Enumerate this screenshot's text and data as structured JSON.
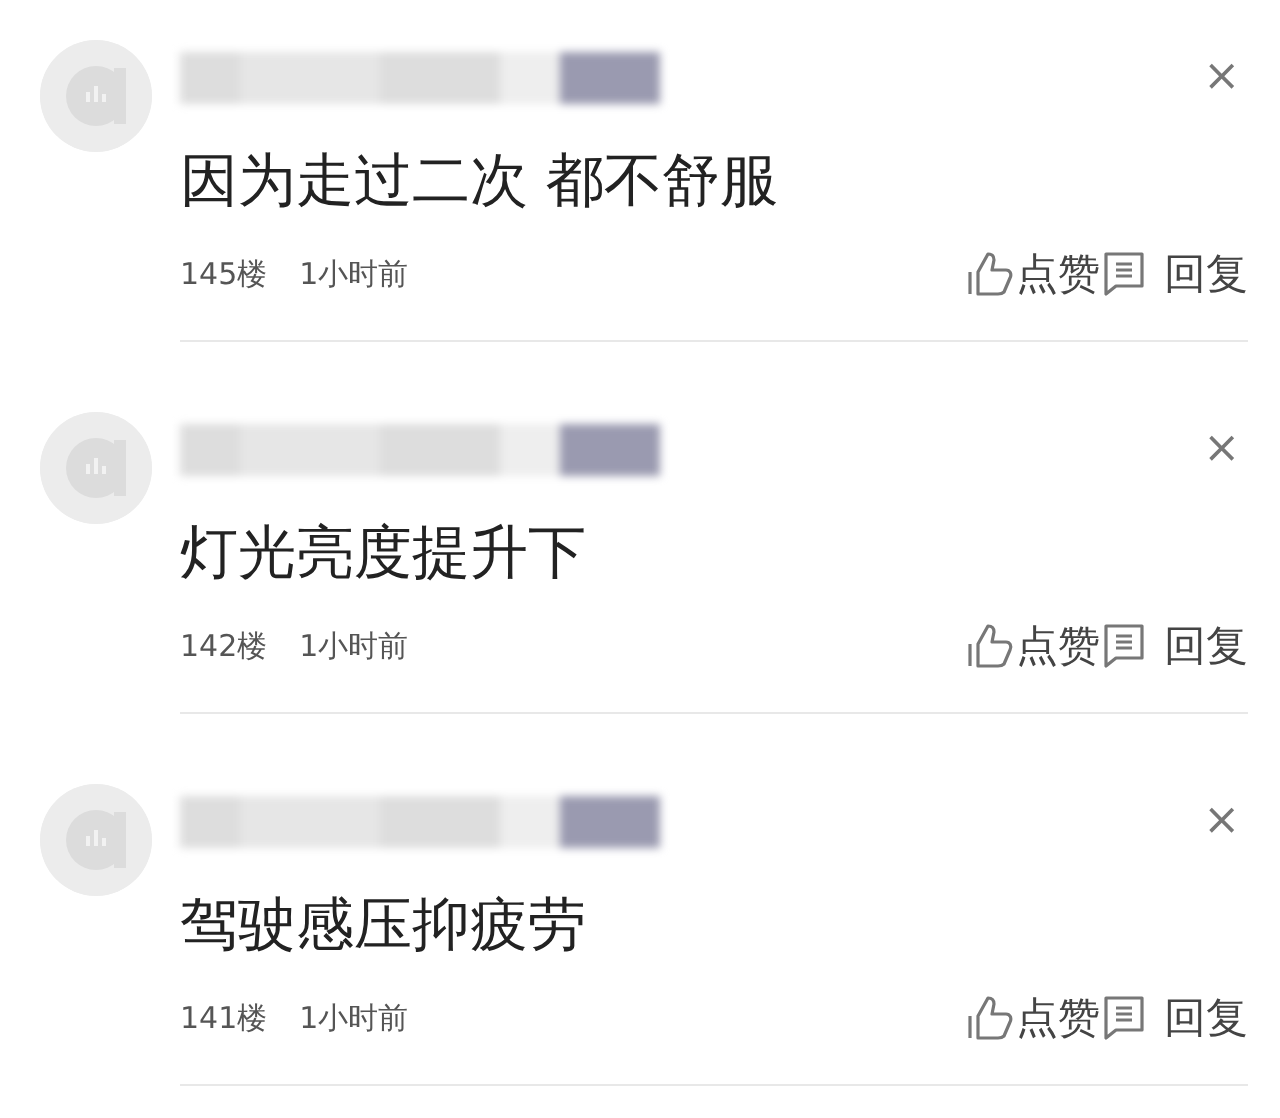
{
  "comments": [
    {
      "text": "因为走过二次 都不舒服",
      "floor": "145楼",
      "time": "1小时前",
      "like_label": "点赞",
      "reply_label": "回复",
      "close": "×"
    },
    {
      "text": "灯光亮度提升下",
      "floor": "142楼",
      "time": "1小时前",
      "like_label": "点赞",
      "reply_label": "回复",
      "close": "×"
    },
    {
      "text": "驾驶感压抑疲劳",
      "floor": "141楼",
      "time": "1小时前",
      "like_label": "点赞",
      "reply_label": "回复",
      "close": "×"
    }
  ]
}
